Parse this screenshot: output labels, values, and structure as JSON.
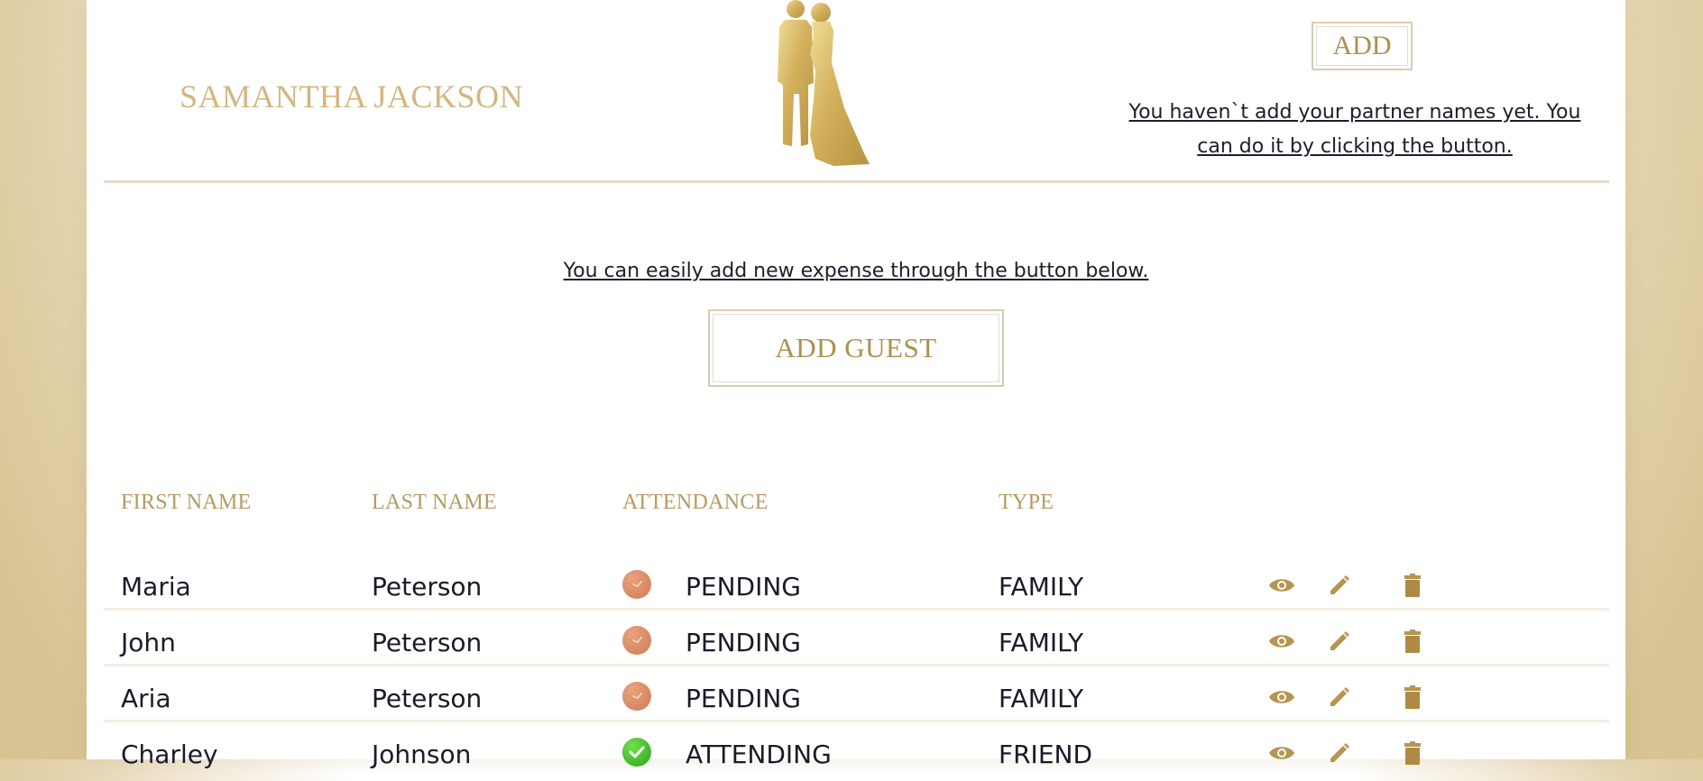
{
  "header": {
    "partner_name": "SAMANTHA JACKSON",
    "add_label": "ADD",
    "partner_hint": "You haven`t add your partner names yet. You can do it by clicking the button."
  },
  "guests_section": {
    "hint": "You can easily add new expense through the button below.",
    "add_guest_label": "ADD GUEST"
  },
  "table": {
    "columns": [
      "FIRST NAME",
      "LAST NAME",
      "ATTENDANCE",
      "TYPE"
    ],
    "rows": [
      {
        "first_name": "Maria",
        "last_name": "Peterson",
        "attendance": "PENDING",
        "type": "FAMILY"
      },
      {
        "first_name": "John",
        "last_name": "Peterson",
        "attendance": "PENDING",
        "type": "FAMILY"
      },
      {
        "first_name": "Aria",
        "last_name": "Peterson",
        "attendance": "PENDING",
        "type": "FAMILY"
      },
      {
        "first_name": "Charley",
        "last_name": "Johnson",
        "attendance": "ATTENDING",
        "type": "FRIEND"
      }
    ],
    "row_actions": [
      "eye-icon",
      "pencil-icon",
      "trash-icon"
    ]
  },
  "colors": {
    "gold": "#b28e4b",
    "pending": "#d98b66",
    "attending": "#3dbb22",
    "border": "#dccbb3"
  }
}
